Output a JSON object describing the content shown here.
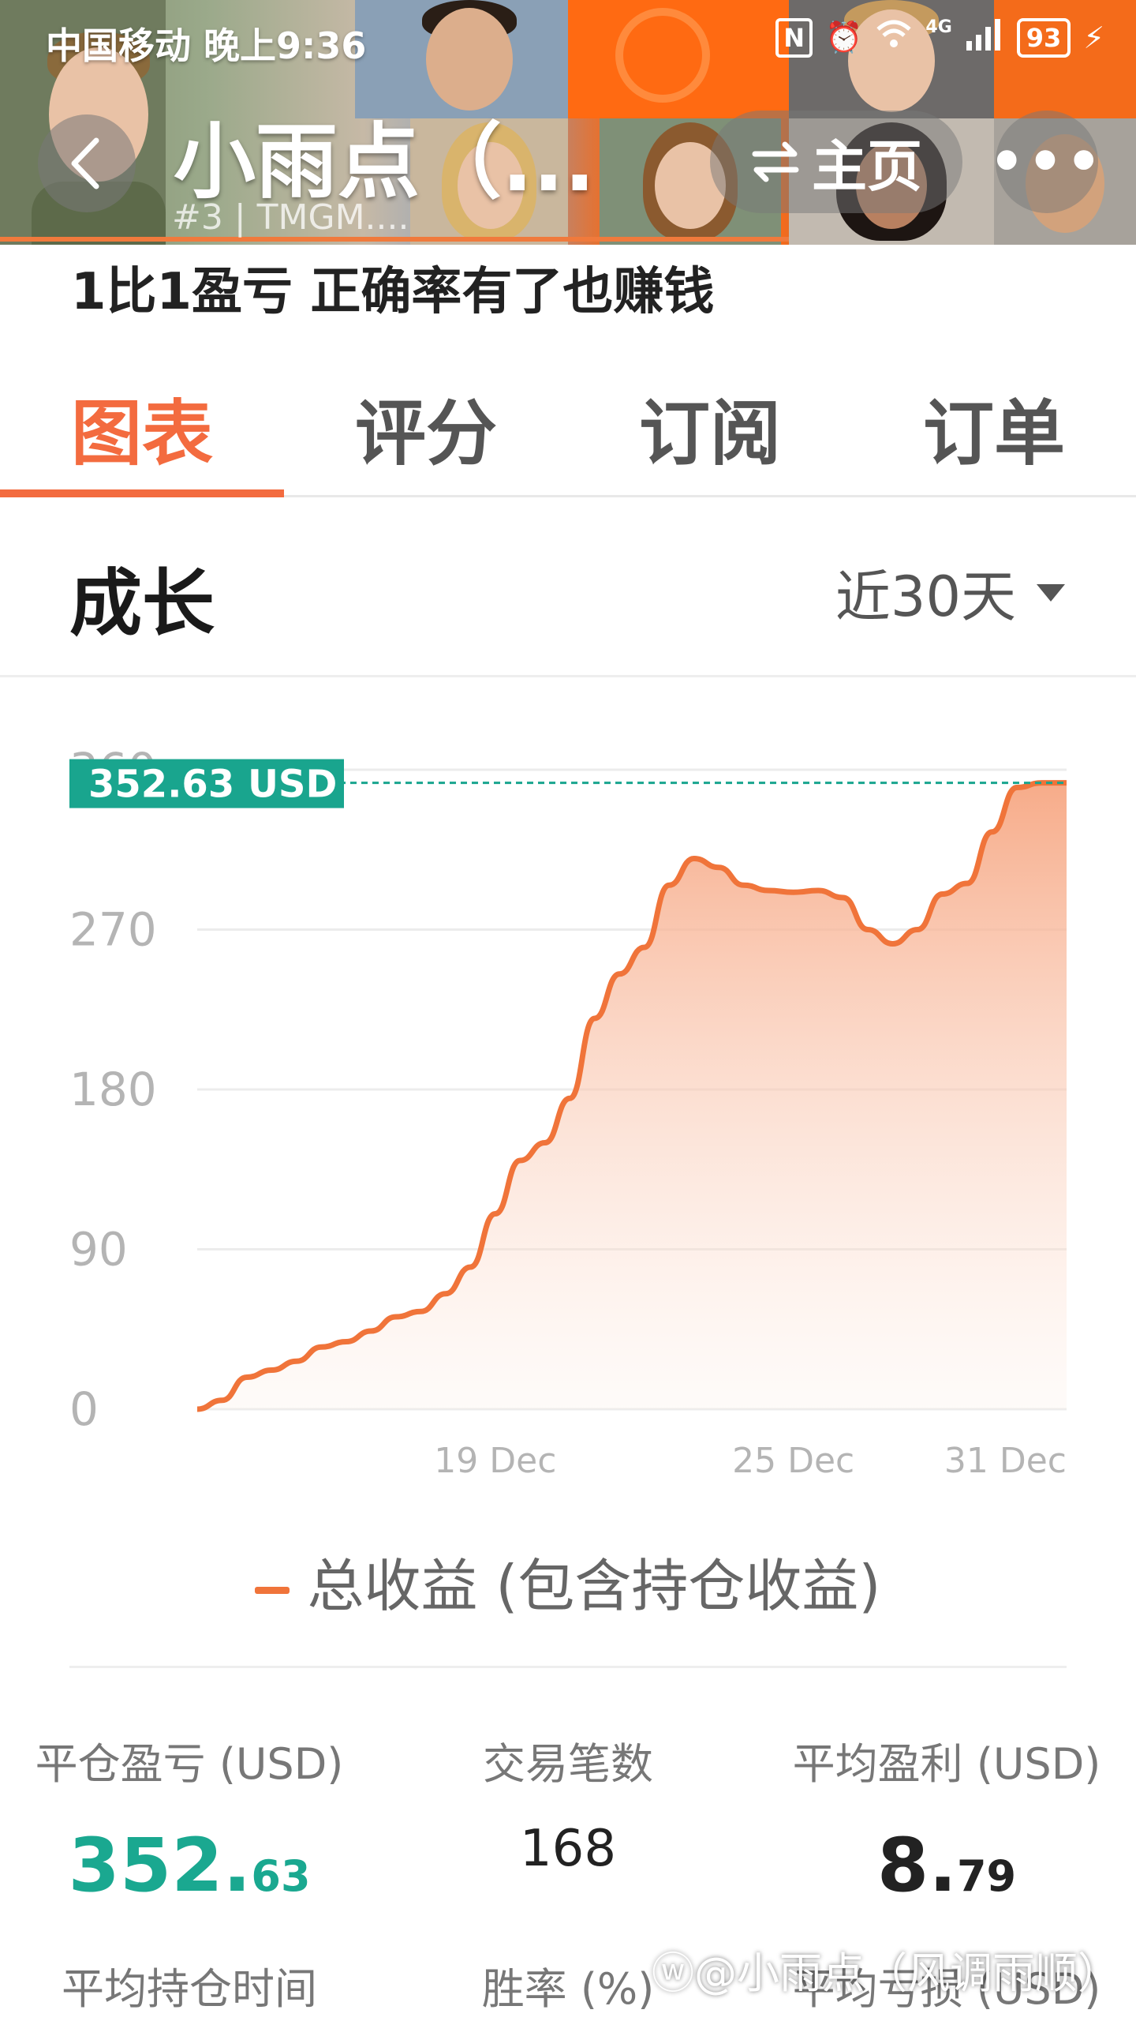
{
  "status_bar": {
    "carrier_time": "中国移动 晚上9:36",
    "nfc": "N",
    "network": "4G",
    "battery": "93"
  },
  "nav": {
    "title": "小雨点（...",
    "subtitle": "#3 | TMGM....",
    "home_label": "主页",
    "more_label": "•••"
  },
  "description": "1比1盈亏 正确率有了也赚钱",
  "tabs": [
    {
      "label": "图表",
      "active": true
    },
    {
      "label": "评分",
      "active": false
    },
    {
      "label": "订阅",
      "active": false
    },
    {
      "label": "订单",
      "active": false
    }
  ],
  "section": {
    "title": "成长",
    "range": "近30天"
  },
  "chart_data": {
    "type": "area",
    "series": [
      {
        "name": "总收益 (包含持仓收益)",
        "values": [
          0,
          5,
          18,
          22,
          27,
          35,
          38,
          44,
          52,
          55,
          65,
          80,
          110,
          140,
          150,
          175,
          220,
          245,
          260,
          295,
          310,
          305,
          295,
          292,
          291,
          292,
          288,
          270,
          262,
          270,
          290,
          296,
          325,
          350,
          352.63,
          352.63
        ]
      }
    ],
    "x_tick_labels": [
      "19 Dec",
      "25 Dec",
      "31 Dec"
    ],
    "x_tick_index": [
      12,
      24,
      35
    ],
    "y_ticks": [
      "0",
      "90",
      "180",
      "270",
      "360"
    ],
    "ylim": [
      0,
      360
    ],
    "current_value_label": "352.63 USD",
    "current_value": 352.63,
    "line_color": "#f0743a",
    "marker_color": "#19a58e"
  },
  "legend": "总收益 (包含持仓收益)",
  "stats": {
    "closed_pnl": {
      "label": "平仓盈亏 (USD)",
      "int": "352.",
      "dec": "63"
    },
    "trades": {
      "label": "交易笔数",
      "value": "168"
    },
    "avg_profit": {
      "label": "平均盈利 (USD)",
      "int": "8.",
      "dec": "79"
    },
    "avg_hold": {
      "label": "平均持仓时间"
    },
    "win_rate": {
      "label": "胜率 (%)"
    },
    "avg_loss": {
      "label": "平均亏损 (USD)"
    }
  },
  "watermark": "@小雨点（风调雨顺）"
}
